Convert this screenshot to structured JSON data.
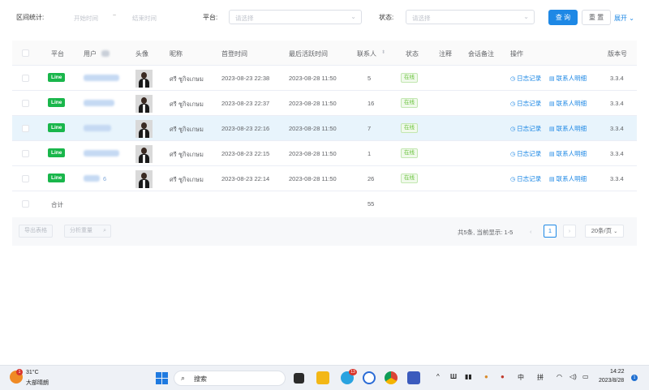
{
  "filter": {
    "range_label": "区间统计:",
    "start_placeholder": "开始时间",
    "end_placeholder": "结束时间",
    "range_separator": "~",
    "platform_label": "平台:",
    "platform_placeholder": "请选择",
    "status_label": "状态:",
    "status_placeholder": "请选择",
    "search_button": "查 询",
    "reset_button": "重 置",
    "expand_link": "展开"
  },
  "table": {
    "headers": {
      "platform": "平台",
      "user": "用户",
      "avatar": "头像",
      "nickname": "昵称",
      "first_login": "首登时间",
      "last_active": "最后活跃时间",
      "contacts": "联系人",
      "sort_icon": "sort-icon",
      "status": "状态",
      "note": "注释",
      "session_note": "会话备注",
      "actions": "操作",
      "version": "版本号"
    },
    "rows": [
      {
        "platform": "Line",
        "nickname": "ศรี ชูกิจเกษม",
        "first_login": "2023-08-23 22:38",
        "last_active": "2023-08-28 11:50",
        "contacts": "5",
        "status": "在线",
        "log": "日志记录",
        "detail": "联系人明细",
        "version": "3.3.4"
      },
      {
        "platform": "Line",
        "nickname": "ศรี ชูกิจเกษม",
        "first_login": "2023-08-23 22:37",
        "last_active": "2023-08-28 11:50",
        "contacts": "16",
        "status": "在线",
        "log": "日志记录",
        "detail": "联系人明细",
        "version": "3.3.4"
      },
      {
        "platform": "Line",
        "nickname": "ศรี ชูกิจเกษม",
        "first_login": "2023-08-23 22:16",
        "last_active": "2023-08-28 11:50",
        "contacts": "7",
        "status": "在线",
        "log": "日志记录",
        "detail": "联系人明细",
        "version": "3.3.4"
      },
      {
        "platform": "Line",
        "nickname": "ศรี ชูกิจเกษม",
        "first_login": "2023-08-23 22:15",
        "last_active": "2023-08-28 11:50",
        "contacts": "1",
        "status": "在线",
        "log": "日志记录",
        "detail": "联系人明细",
        "version": "3.3.4"
      },
      {
        "platform": "Line",
        "user_suffix": "6",
        "nickname": "ศรี ชูกิจเกษม",
        "first_login": "2023-08-23 22:14",
        "last_active": "2023-08-28 11:50",
        "contacts": "26",
        "status": "在线",
        "log": "日志记录",
        "detail": "联系人明细",
        "version": "3.3.4"
      }
    ],
    "total_label": "合计",
    "total_contacts": "55"
  },
  "footer": {
    "export_button": "导出表格",
    "analyze_button": "分析重量",
    "summary": "共5条, 当前显示: 1-5",
    "prev": "‹",
    "current_page": "1",
    "next": "›",
    "page_size": "20条/页"
  },
  "taskbar": {
    "weather_temp": "31°C",
    "weather_desc": "大部晴朗",
    "search_text": "搜索",
    "telegram_badge": "13",
    "ime_lang": "中",
    "ime_mode": "拼",
    "time": "14:22",
    "date": "2023/8/28",
    "notif_count": "1"
  },
  "colors": {
    "primary": "#1e88e5",
    "line_green": "#19b64b",
    "status_green": "#67c23a",
    "row_highlight": "#e8f4fc"
  }
}
